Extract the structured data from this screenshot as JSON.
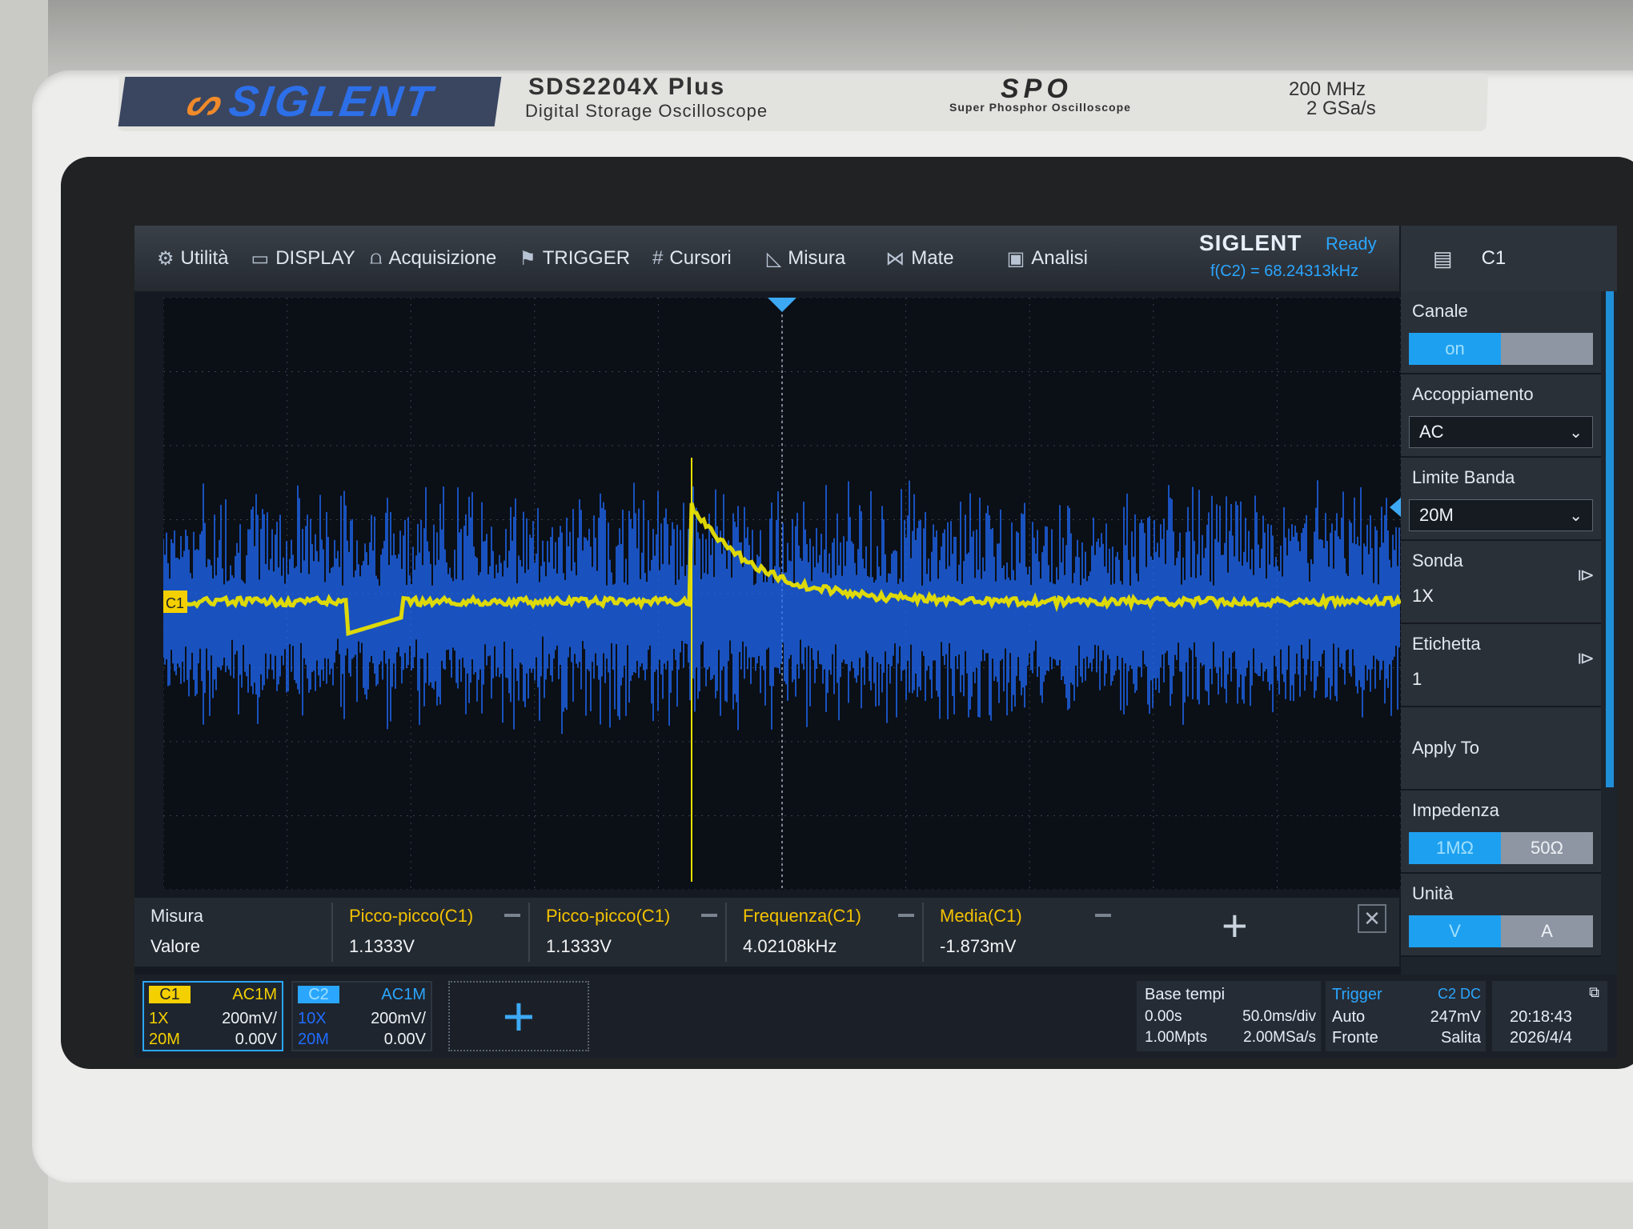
{
  "brand": {
    "logo": "SIGLENT",
    "model": "SDS2204X Plus",
    "model_sub": "Digital Storage Oscilloscope",
    "spo": "SPO",
    "spo_sub": "Super Phosphor Oscilloscope",
    "bandwidth": "200 MHz",
    "sample_rate": "2 GSa/s"
  },
  "menu": {
    "items": [
      {
        "label": "Utilità",
        "icon": "gear-icon",
        "glyph": "⚙"
      },
      {
        "label": "DISPLAY",
        "icon": "monitor-icon",
        "glyph": "▭"
      },
      {
        "label": "Acquisizione",
        "icon": "acquire-icon",
        "glyph": "⩍"
      },
      {
        "label": "TRIGGER",
        "icon": "flag-icon",
        "glyph": "⚑"
      },
      {
        "label": "Cursori",
        "icon": "cursor-grid-icon",
        "glyph": "#"
      },
      {
        "label": "Misura",
        "icon": "measure-icon",
        "glyph": "◺"
      },
      {
        "label": "Mate",
        "icon": "math-icon",
        "glyph": "⋈"
      },
      {
        "label": "Analisi",
        "icon": "analysis-icon",
        "glyph": "▣"
      }
    ]
  },
  "status": {
    "logo": "SIGLENT",
    "state": "Ready",
    "frequency": "f(C2) = 68.24313kHz"
  },
  "channel_header": {
    "label": "C1",
    "icon": "clipboard-icon"
  },
  "right_panel": {
    "canale": {
      "label": "Canale",
      "on": "on",
      "off": ""
    },
    "accoppiamento": {
      "label": "Accoppiamento",
      "value": "AC"
    },
    "limite_banda": {
      "label": "Limite Banda",
      "value": "20M"
    },
    "sonda": {
      "label": "Sonda",
      "value": "1X"
    },
    "etichetta": {
      "label": "Etichetta",
      "value": "1"
    },
    "apply": {
      "label": "Apply To"
    },
    "impedenza": {
      "label": "Impedenza",
      "opt1": "1MΩ",
      "opt2": "50Ω"
    },
    "unita": {
      "label": "Unità",
      "opt1": "V",
      "opt2": "A"
    }
  },
  "waveform": {
    "c1_marker": "C1",
    "colors": {
      "c1": "#e8e000",
      "c2": "#1f6dff",
      "grid": "#3a4250"
    }
  },
  "measurements": {
    "header_label": "Misura",
    "value_label": "Valore",
    "items": [
      {
        "name": "Picco-picco(C1)",
        "value": "1.1333V"
      },
      {
        "name": "Picco-picco(C1)",
        "value": "1.1333V"
      },
      {
        "name": "Frequenza(C1)",
        "value": "4.02108kHz"
      },
      {
        "name": "Media(C1)",
        "value": "-1.873mV"
      }
    ]
  },
  "channels": [
    {
      "tag": "C1",
      "coupling": "AC1M",
      "probe": "1X",
      "scale": "200mV/",
      "bw": "20M",
      "offset": "0.00V",
      "color": "#f4d000"
    },
    {
      "tag": "C2",
      "coupling": "AC1M",
      "probe": "10X",
      "scale": "200mV/",
      "bw": "20M",
      "offset": "0.00V",
      "color": "#2aa6ff"
    }
  ],
  "timebase": {
    "label": "Base tempi",
    "delay": "0.00s",
    "scale": "50.0ms/div",
    "points": "1.00Mpts",
    "rate": "2.00MSa/s"
  },
  "trigger": {
    "label": "Trigger",
    "source": "C2 DC",
    "mode": "Auto",
    "level": "247mV",
    "type": "Fronte",
    "slope": "Salita"
  },
  "clock": {
    "time": "20:18:43",
    "date": "2026/4/4"
  }
}
